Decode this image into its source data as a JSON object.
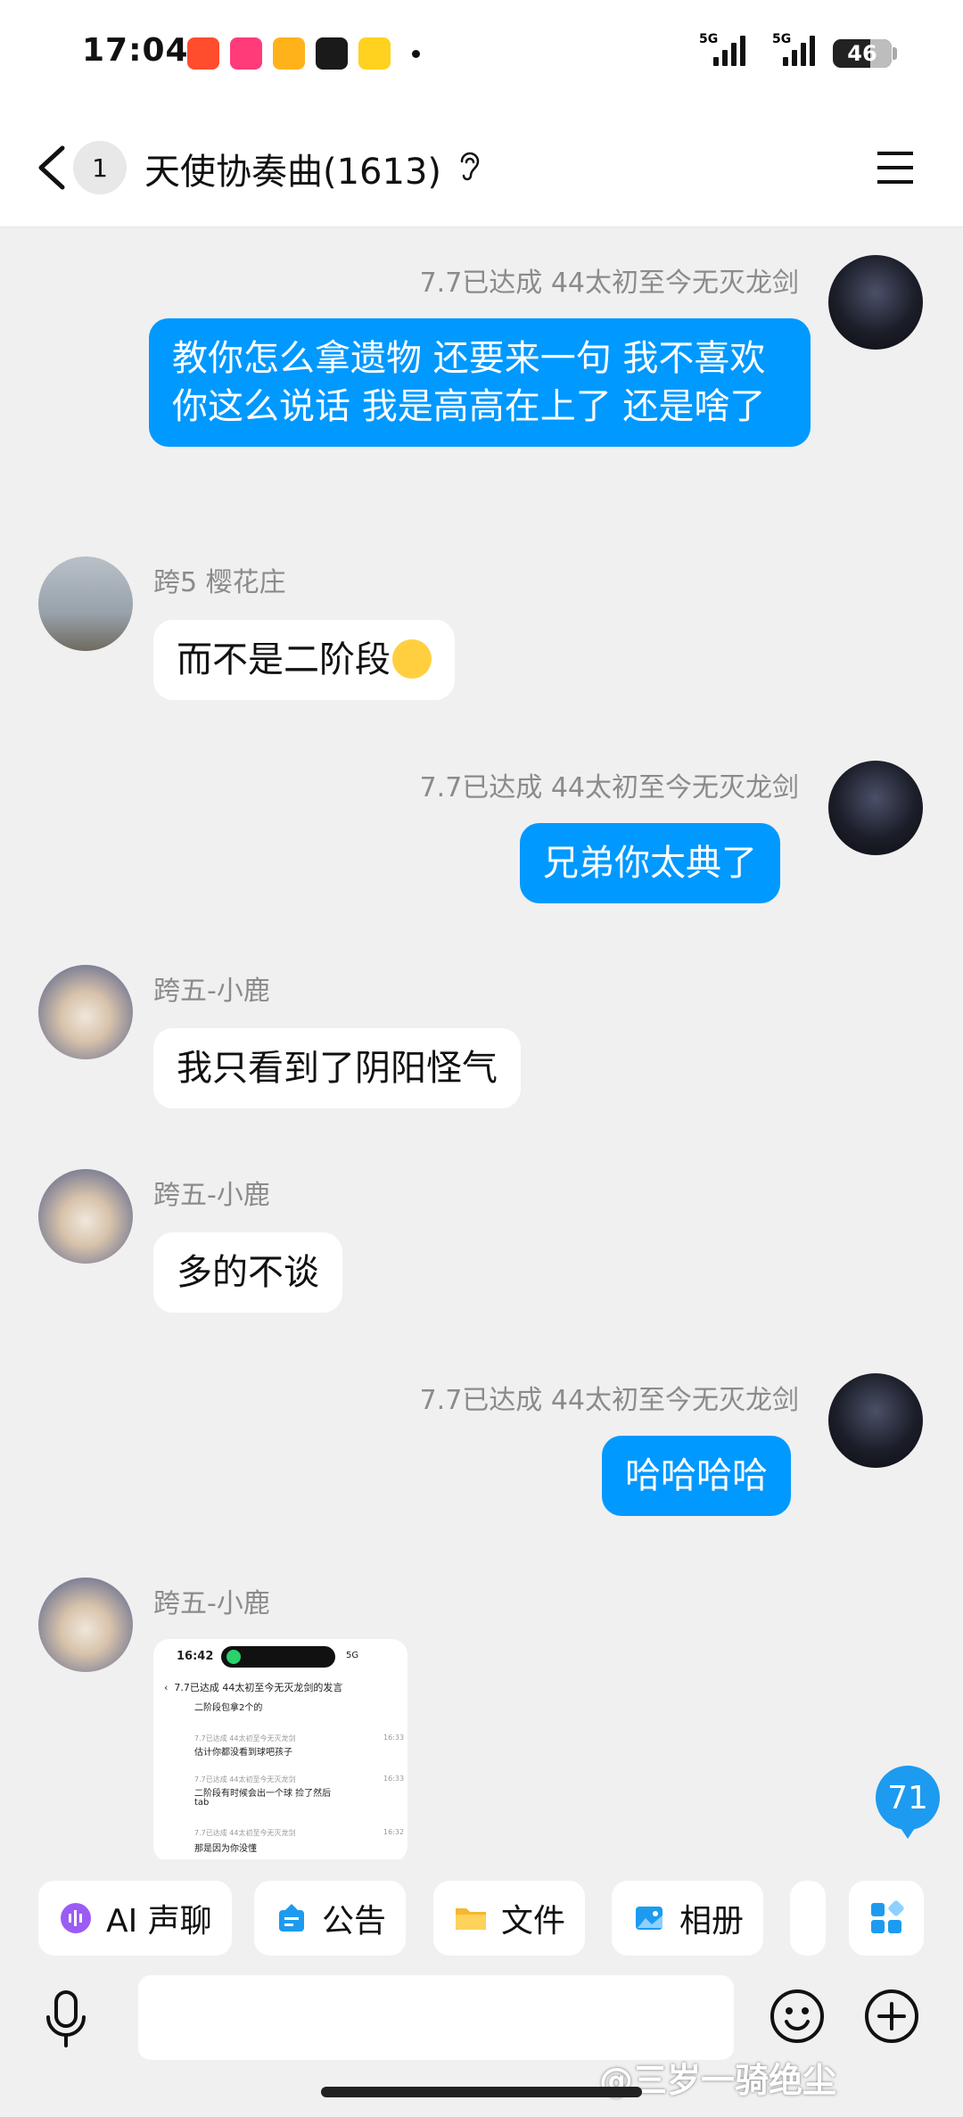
{
  "status": {
    "time": "17:04",
    "net1": "5G",
    "net2": "5G",
    "battery": "46"
  },
  "header": {
    "back_badge": "1",
    "title": "天使协奏曲(1613)"
  },
  "messages": [
    {
      "sender": "7.7已达成   44太初至今无灭龙剑",
      "text": "教你怎么拿遗物 还要来一句 我不喜欢你这么说话 我是高高在上了 还是啥了"
    },
    {
      "sender": "跨5 樱花庄",
      "text": "而不是二阶段"
    },
    {
      "sender": "7.7已达成   44太初至今无灭龙剑",
      "text": "兄弟你太典了"
    },
    {
      "sender": "跨五-小鹿",
      "text": "我只看到了阴阳怪气"
    },
    {
      "sender": "跨五-小鹿",
      "text": "多的不谈"
    },
    {
      "sender": "7.7已达成   44太初至今无灭龙剑",
      "text": "哈哈哈哈"
    },
    {
      "sender": "跨五-小鹿"
    }
  ],
  "screenshot": {
    "time": "16:42",
    "status": "5G",
    "title": "7.7已达成   44太初至今无灭龙剑的发言",
    "lines": [
      {
        "text": "二阶段包拿2个的"
      },
      {
        "meta": "7.7已达成  44太初至今无灭龙剑",
        "ts": "16:33",
        "text": "估计你都没看到球吧孩子"
      },
      {
        "meta": "7.7已达成  44太初至今无灭龙剑",
        "ts": "16:33",
        "text": "二阶段有时候会出一个球 捡了然后",
        "text2": "tab"
      },
      {
        "meta": "7.7已达成  44太初至今无灭龙剑",
        "ts": "16:32",
        "text": "那是因为你没懂"
      }
    ]
  },
  "unread_count": "71",
  "toolbar": [
    {
      "label": "AI 声聊",
      "icon": "ai-voice-icon",
      "color": "#9b5cf6"
    },
    {
      "label": "公告",
      "icon": "announcement-icon",
      "color": "#1d9bf0"
    },
    {
      "label": "文件",
      "icon": "folder-icon",
      "color": "#f5b731"
    },
    {
      "label": "相册",
      "icon": "album-icon",
      "color": "#1d9bf0"
    }
  ],
  "watermark": "@三岁一骑绝尘"
}
